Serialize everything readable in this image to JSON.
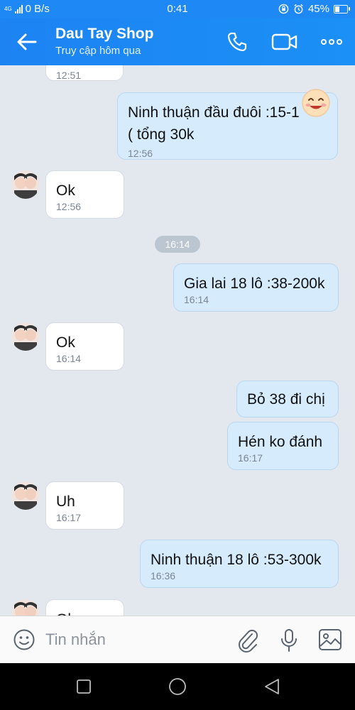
{
  "status_bar": {
    "network": "4G",
    "speed": "0 B/s",
    "time": "0:41",
    "battery": "45%",
    "battery_level": 0.45
  },
  "header": {
    "title": "Dau Tay Shop",
    "subtitle": "Truy cập hôm qua"
  },
  "chat": {
    "messages": [
      {
        "dir": "in",
        "text": "",
        "time": "12:51"
      },
      {
        "dir": "out",
        "text": "Ninh thuận đầu đuôi :15-1",
        "text2": "( tổng 30k",
        "time": "12:56"
      },
      {
        "dir": "in",
        "text": "Ok",
        "time": "12:56"
      },
      {
        "dir": "out",
        "text": "Gia lai 18 lô :38-200k",
        "time": "16:14"
      },
      {
        "dir": "in",
        "text": "Ok",
        "time": "16:14"
      },
      {
        "dir": "out",
        "text": "Bỏ 38 đi chị",
        "time": ""
      },
      {
        "dir": "out",
        "text": "Hén ko đánh",
        "time": "16:17"
      },
      {
        "dir": "in",
        "text": "Uh",
        "time": "16:17"
      },
      {
        "dir": "out",
        "text": "Ninh thuận 18 lô :53-300k",
        "time": "16:36"
      },
      {
        "dir": "in",
        "text": "Ok",
        "time": ""
      }
    ],
    "divider": "16:14"
  },
  "input": {
    "placeholder": "Tin nhắn"
  },
  "colors": {
    "header": "#1d83f3",
    "background": "#e3e8ef",
    "out_bubble": "#d6ecfd",
    "in_bubble": "#ffffff"
  }
}
